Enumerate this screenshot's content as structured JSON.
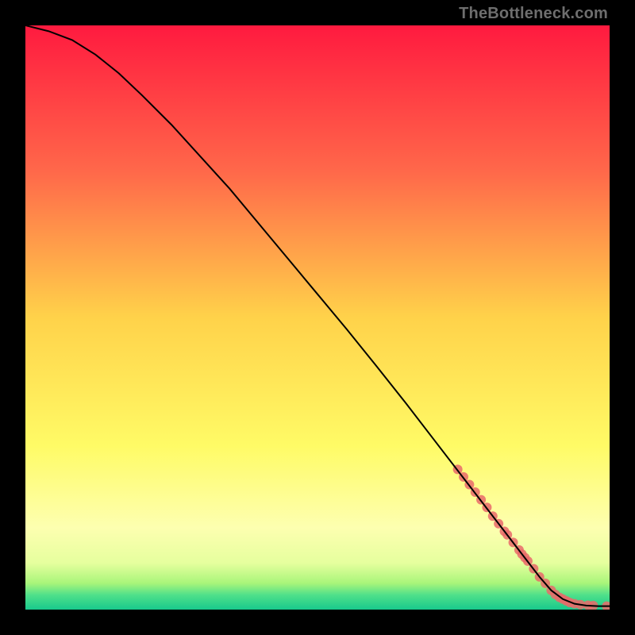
{
  "watermark": "TheBottleneck.com",
  "chart_data": {
    "type": "line",
    "xlabel": "",
    "ylabel": "",
    "xlim": [
      0,
      100
    ],
    "ylim": [
      0,
      100
    ],
    "grid": false,
    "legend": false,
    "gradient_stops": [
      {
        "pos": 0.0,
        "color": "#ff1a3f"
      },
      {
        "pos": 0.25,
        "color": "#ff684a"
      },
      {
        "pos": 0.5,
        "color": "#ffd24a"
      },
      {
        "pos": 0.72,
        "color": "#fffb66"
      },
      {
        "pos": 0.86,
        "color": "#fdffb0"
      },
      {
        "pos": 0.92,
        "color": "#e6ff9e"
      },
      {
        "pos": 0.955,
        "color": "#a8f57a"
      },
      {
        "pos": 0.975,
        "color": "#4fe08a"
      },
      {
        "pos": 1.0,
        "color": "#18c98c"
      }
    ],
    "series": [
      {
        "name": "curve",
        "style": "line",
        "color": "#000000",
        "x": [
          0,
          4,
          8,
          12,
          16,
          20,
          25,
          30,
          35,
          40,
          45,
          50,
          55,
          60,
          65,
          70,
          75,
          80,
          85,
          88,
          90,
          92,
          94,
          96,
          98,
          100
        ],
        "y": [
          100,
          99,
          97.5,
          95,
          91.8,
          88,
          83,
          77.5,
          72,
          66,
          60,
          54,
          48,
          41.8,
          35.5,
          29,
          22.5,
          16,
          9.5,
          5.6,
          3.3,
          1.8,
          1.0,
          0.7,
          0.6,
          0.6
        ]
      },
      {
        "name": "markers",
        "style": "scatter",
        "color": "#e96a6a",
        "x": [
          74,
          75,
          76,
          77,
          78,
          79,
          80,
          81,
          82,
          82.5,
          83.5,
          84.5,
          85,
          85.5,
          86,
          87,
          88,
          89,
          90,
          90.7,
          91.4,
          92,
          92.6,
          93.2,
          94,
          95,
          96.3,
          97.2,
          99.5
        ],
        "y": [
          24.0,
          22.7,
          21.4,
          20.1,
          18.8,
          17.5,
          16.0,
          14.7,
          13.4,
          12.8,
          11.5,
          10.2,
          9.5,
          8.9,
          8.3,
          7.0,
          5.6,
          4.5,
          3.3,
          2.6,
          2.1,
          1.8,
          1.5,
          1.2,
          1.0,
          0.85,
          0.75,
          0.7,
          0.6
        ]
      }
    ]
  }
}
